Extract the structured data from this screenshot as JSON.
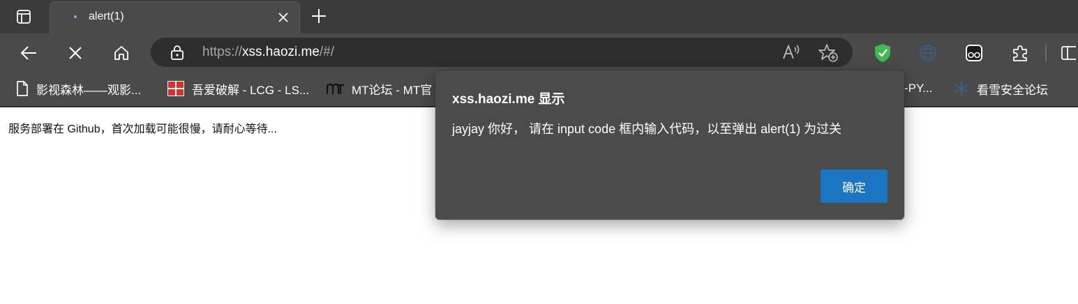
{
  "tab": {
    "title": "alert(1)"
  },
  "address_bar": {
    "url_scheme": "https://",
    "url_host": "xss.haozi.me",
    "url_path": "/#/"
  },
  "bookmarks": [
    {
      "label": "影视森林——观影...",
      "icon": "page-icon"
    },
    {
      "label": "吾爱破解 - LCG - LS...",
      "icon": "52pojie-logo"
    },
    {
      "label": "MT论坛 - MT官",
      "icon": "mt-logo"
    },
    {
      "label": "-PY...",
      "icon": "none"
    },
    {
      "label": "看雪安全论坛",
      "icon": "kanxue-logo"
    }
  ],
  "page": {
    "body_text": "服务部署在 Github，首次加载可能很慢，请耐心等待..."
  },
  "dialog": {
    "title": "xss.haozi.me 显示",
    "message": "jayjay 你好， 请在 input code 框内输入代码，以至弹出 alert(1) 为过关",
    "ok_label": "确定"
  },
  "colors": {
    "accent": "#1c75c3",
    "chrome": "#4a4a4a",
    "tabstrip": "#3b3b3b",
    "shield": "#3fb950"
  }
}
